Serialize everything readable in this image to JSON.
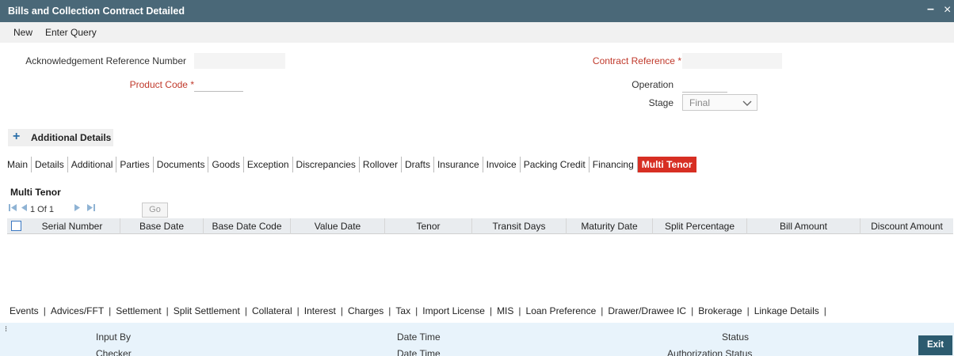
{
  "window": {
    "title": "Bills and Collection Contract Detailed",
    "minimize": "–",
    "close": "×"
  },
  "menu": {
    "new": "New",
    "enter_query": "Enter Query"
  },
  "form": {
    "ack_ref_label": "Acknowledgement Reference Number",
    "ack_ref_value": "",
    "product_code_label": "Product Code",
    "product_code_value": "",
    "contract_ref_label": "Contract Reference",
    "contract_ref_value": "",
    "operation_label": "Operation",
    "operation_value": "",
    "stage_label": "Stage",
    "stage_value": "Final",
    "required_mark": "*"
  },
  "additional_details": {
    "plus": "+",
    "label": "Additional Details"
  },
  "tabs": [
    "Main",
    "Details",
    "Additional",
    "Parties",
    "Documents",
    "Goods",
    "Exception",
    "Discrepancies",
    "Rollover",
    "Drafts",
    "Insurance",
    "Invoice",
    "Packing Credit",
    "Financing",
    "Multi Tenor"
  ],
  "active_tab": "Multi Tenor",
  "multi_tenor": {
    "title": "Multi Tenor",
    "pager": {
      "first": "◀",
      "prev": "◀",
      "page_text": "1 Of 1",
      "next": "▶",
      "last": "▶",
      "go": "Go"
    },
    "columns": [
      "Serial Number",
      "Base Date",
      "Base Date Code",
      "Value Date",
      "Tenor",
      "Transit Days",
      "Maturity Date",
      "Split Percentage",
      "Bill Amount",
      "Discount Amount"
    ]
  },
  "subsystems": [
    "Events",
    "Advices/FFT",
    "Settlement",
    "Split Settlement",
    "Collateral",
    "Interest",
    "Charges",
    "Tax",
    "Import License",
    "MIS",
    "Loan Preference",
    "Drawer/Drawee IC",
    "Brokerage",
    "Linkage Details"
  ],
  "subsystem_separator": "|",
  "footer": {
    "input_by": "Input By",
    "checker": "Checker",
    "date_time_1": "Date Time",
    "date_time_2": "Date Time",
    "status": "Status",
    "authorization_status": "Authorization Status",
    "exit": "Exit"
  },
  "colors": {
    "titlebar": "#4a6878",
    "active_tab": "#d72f23",
    "required": "#c0392b",
    "footer_bg": "#e8f3fb",
    "exit_button": "#2c5b6f"
  }
}
